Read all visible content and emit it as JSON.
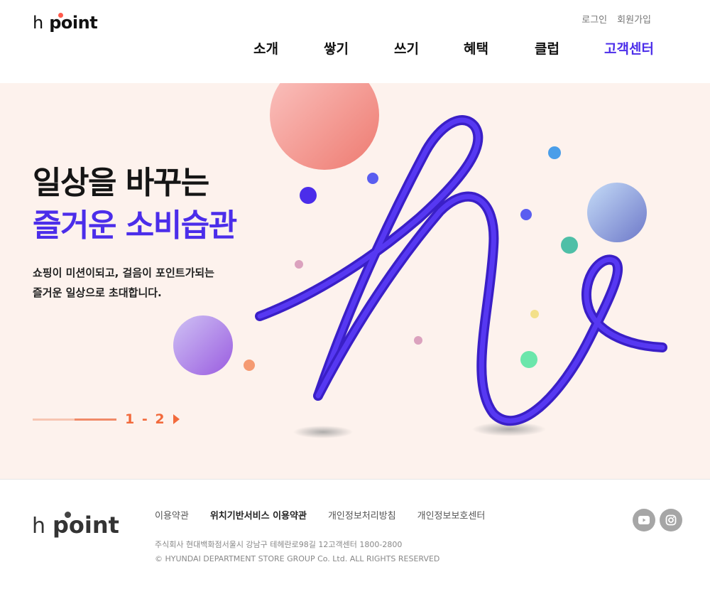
{
  "header": {
    "logo_h": "h",
    "logo_point": "point",
    "util": {
      "login": "로그인",
      "signup": "회원가입"
    },
    "nav": [
      {
        "label": "소개",
        "active": false
      },
      {
        "label": "쌓기",
        "active": false
      },
      {
        "label": "쓰기",
        "active": false
      },
      {
        "label": "혜택",
        "active": false
      },
      {
        "label": "클럽",
        "active": false
      },
      {
        "label": "고객센터",
        "active": true
      }
    ]
  },
  "hero": {
    "title_line1": "일상을 바꾸는",
    "title_line2": "즐거운 소비습관",
    "desc_line1": "쇼핑이 미션이되고, 걸음이 포인트가되는",
    "desc_line2": "즐거운 일상으로 초대합니다.",
    "pager": {
      "current": 1,
      "total": 2,
      "label": "1 - 2"
    }
  },
  "footer": {
    "logo_h": "h",
    "logo_point": "point",
    "links": [
      {
        "label": "이용약관",
        "bold": false
      },
      {
        "label": "위치기반서비스 이용약관",
        "bold": true
      },
      {
        "label": "개인정보처리방침",
        "bold": false
      },
      {
        "label": "개인정보보호센터",
        "bold": false
      }
    ],
    "company_info": "주식회사 현대백화점서울시 강남구 테헤란로98길 12고객센터 1800-2800",
    "copyright": "© HYUNDAI DEPARTMENT STORE GROUP Co. Ltd. ALL RIGHTS RESERVED",
    "social": [
      "youtube-icon",
      "instagram-icon"
    ]
  },
  "colors": {
    "accent": "#4b2dea",
    "hero_bg": "#fdf2ed",
    "pager": "#f26a3c",
    "logo_dot": "#ff5a4b"
  }
}
